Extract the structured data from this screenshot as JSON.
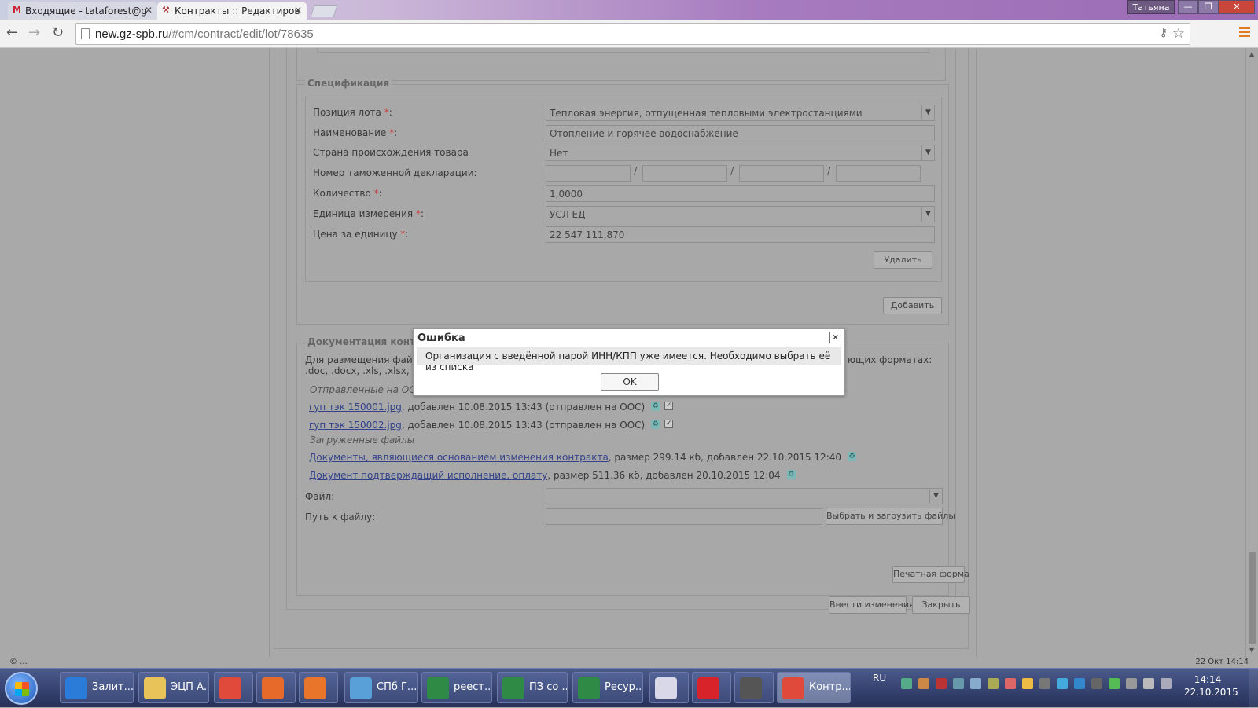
{
  "browser": {
    "tabs": [
      {
        "title": "Входящие - tataforest@g",
        "icon": "gmail-icon"
      },
      {
        "title": "Контракты :: Редактиров",
        "icon": "tools-icon"
      }
    ],
    "user": "Татьяна",
    "window_buttons": {
      "minimize": "—",
      "restore": "❐",
      "close": "✕"
    },
    "url_host": "new.gz-spb.ru",
    "url_path": "/#cm/contract/edit/lot/78635"
  },
  "specification": {
    "legend": "Спецификация",
    "fields": {
      "lot_position": {
        "label": "Позиция лота",
        "value": "Тепловая энергия, отпущенная тепловыми электростанциями"
      },
      "name": {
        "label": "Наименование",
        "value": "Отопление и горячее водоснабжение"
      },
      "country": {
        "label": "Страна происхождения товара",
        "value": "Нет"
      },
      "customs": {
        "label": "Номер таможенной декларации:",
        "parts": [
          "",
          "",
          "",
          ""
        ]
      },
      "quantity": {
        "label": "Количество",
        "value": "1,0000"
      },
      "unit": {
        "label": "Единица измерения",
        "value": "УСЛ ЕД"
      },
      "price": {
        "label": "Цена за единицу",
        "value": "22 547 111,870"
      }
    },
    "required_mark": "*",
    "colon": ":",
    "delete_button": "Удалить",
    "add_button": "Добавить"
  },
  "documentation": {
    "legend": "Документация контрак",
    "info_line1_left": "Для размещения файлов",
    "info_line1_right": "ющих форматах:",
    "info_line2": ".doc, .docx, .xls, .xlsx, .t",
    "sent_heading": "Отправленные на ООС",
    "sent_files": [
      {
        "name": "гуп тэк 150001.jpg",
        "meta": ", добавлен 10.08.2015 13:43 (отправлен на ООС)"
      },
      {
        "name": "гуп тэк 150002.jpg",
        "meta": ", добавлен 10.08.2015 13:43 (отправлен на ООС)"
      }
    ],
    "uploaded_heading": "Загруженные файлы",
    "uploaded_files": [
      {
        "name": "Документы, являющиеся основанием изменения контракта",
        "meta": ", размер 299.14 кб, добавлен 22.10.2015 12:40"
      },
      {
        "name": "Документ подтверждащий исполнение, оплату",
        "meta": ", размер 511.36 кб, добавлен 20.10.2015 12:04"
      }
    ],
    "file_label": "Файл:",
    "path_label": "Путь к файлу:",
    "upload_button": "Выбрать и загрузить файлы"
  },
  "actions": {
    "print": "Печатная форма",
    "save": "Внести изменения",
    "close": "Закрыть"
  },
  "dialog": {
    "title": "Ошибка",
    "message": "Организация с введённой парой ИНН/КПП уже имеется. Необходимо выбрать её из списка",
    "ok": "OK",
    "close": "✕"
  },
  "status": {
    "left": "© ...",
    "right": "22 Окт 14:14"
  },
  "taskbar": {
    "items": [
      {
        "label": "Залит...",
        "icon": "ie-icon",
        "color": "#2b7bd8"
      },
      {
        "label": "ЭЦП А...",
        "icon": "folder-icon",
        "color": "#e8c35a"
      },
      {
        "label": "",
        "icon": "chrome-icon",
        "color": "#e04a3a"
      },
      {
        "label": "",
        "icon": "ms-office-icon",
        "color": "#e86a2a"
      },
      {
        "label": "",
        "icon": "firefox-icon",
        "color": "#e8752a"
      },
      {
        "label": "СПб Г...",
        "icon": "app-icon",
        "color": "#5aa0d8"
      },
      {
        "label": "реест...",
        "icon": "excel-icon",
        "color": "#2f8a46"
      },
      {
        "label": "ПЗ со ...",
        "icon": "excel-icon",
        "color": "#2f8a46"
      },
      {
        "label": "Ресур...",
        "icon": "excel-icon",
        "color": "#2f8a46"
      },
      {
        "label": "",
        "icon": "editor-icon",
        "color": "#d8d8e8"
      },
      {
        "label": "",
        "icon": "opera-icon",
        "color": "#d8232a"
      },
      {
        "label": "",
        "icon": "media-icon",
        "color": "#555"
      },
      {
        "label": "Контр...",
        "icon": "chrome-icon",
        "color": "#e04a3a"
      }
    ],
    "lang": "RU",
    "time": "14:14",
    "date": "22.10.2015"
  }
}
